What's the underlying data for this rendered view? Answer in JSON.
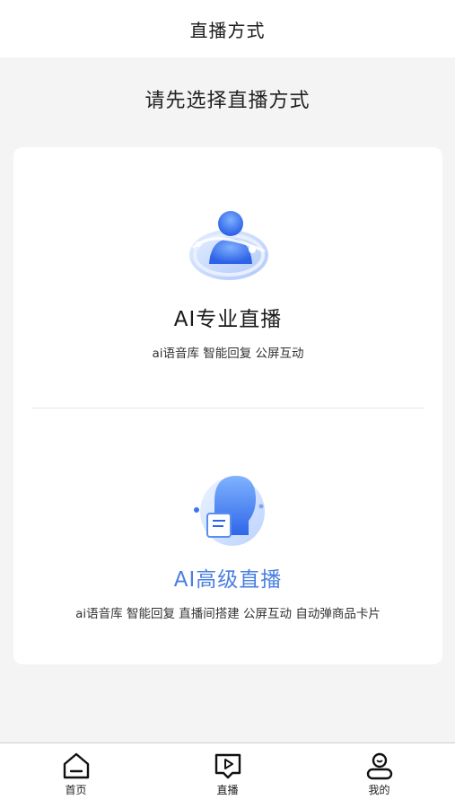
{
  "header": {
    "title": "直播方式"
  },
  "prompt": "请先选择直播方式",
  "options": [
    {
      "title": "AI专业直播",
      "desc": "ai语音库 智能回复 公屏互动",
      "icon": "ai-avatar-orbit-icon"
    },
    {
      "title": "AI高级直播",
      "desc": "ai语音库 智能回复 直播间搭建 公屏互动 自动弹商品卡片",
      "icon": "ai-head-profile-icon",
      "accent": "#4a7fe0"
    }
  ],
  "tabbar": {
    "items": [
      {
        "label": "首页",
        "icon": "home-icon"
      },
      {
        "label": "直播",
        "icon": "live-play-icon"
      },
      {
        "label": "我的",
        "icon": "user-icon"
      }
    ]
  }
}
